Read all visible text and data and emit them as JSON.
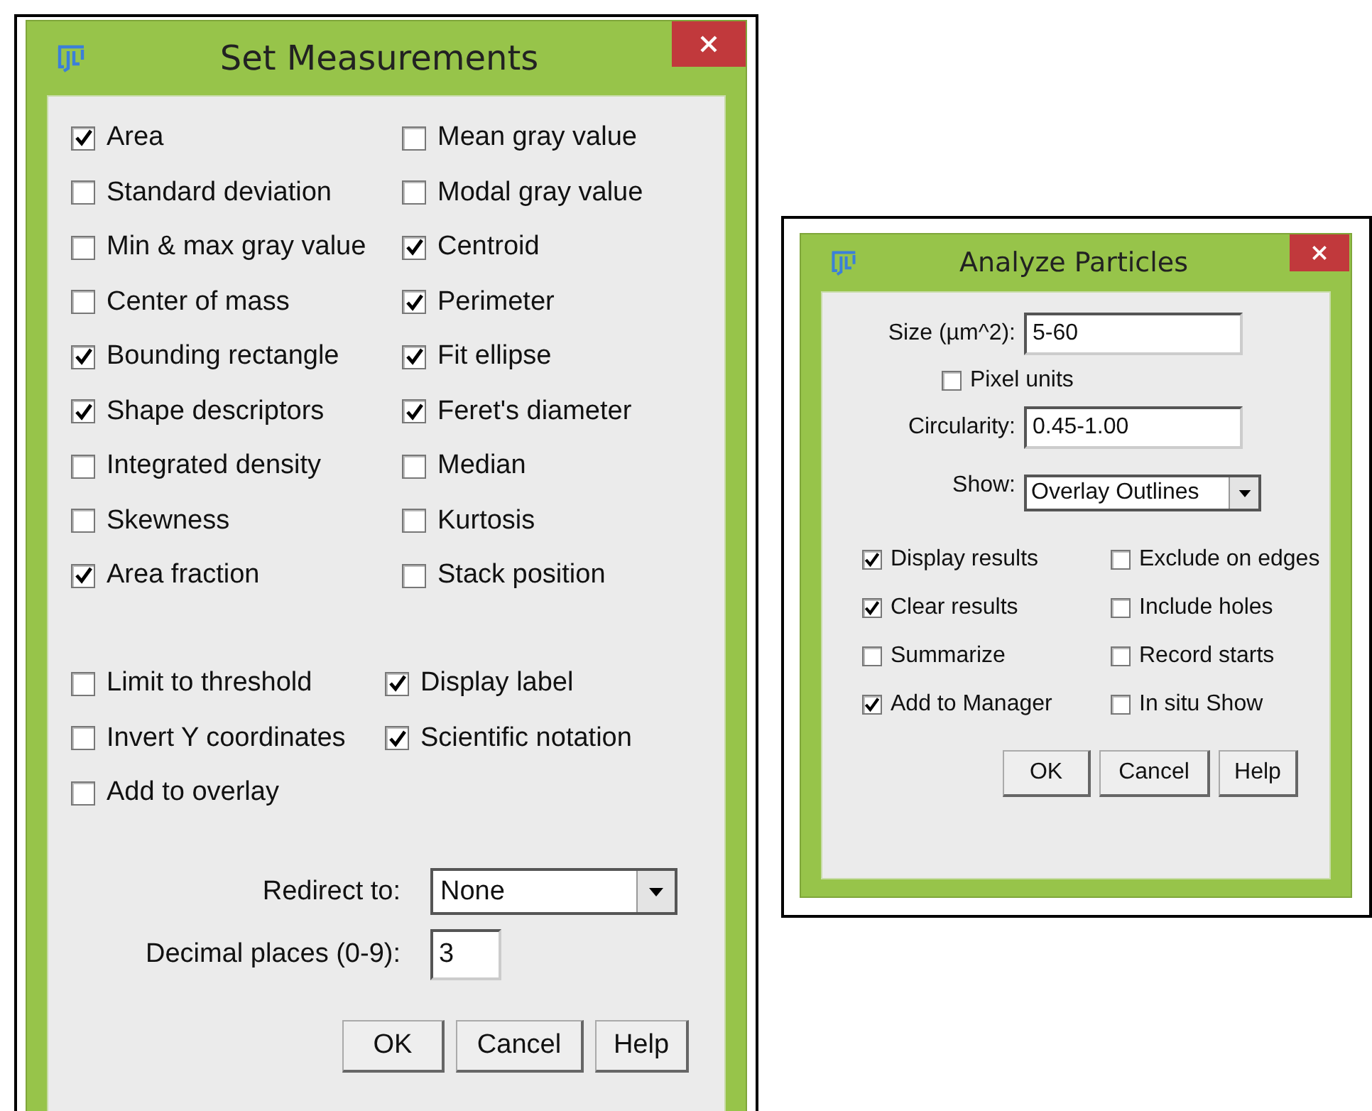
{
  "set_measurements": {
    "title": "Set Measurements",
    "measurements": [
      {
        "label": "Area",
        "checked": true
      },
      {
        "label": "Mean gray value",
        "checked": false
      },
      {
        "label": "Standard deviation",
        "checked": false
      },
      {
        "label": "Modal gray value",
        "checked": false
      },
      {
        "label": "Min & max gray value",
        "checked": false
      },
      {
        "label": "Centroid",
        "checked": true
      },
      {
        "label": "Center of mass",
        "checked": false
      },
      {
        "label": "Perimeter",
        "checked": true
      },
      {
        "label": "Bounding rectangle",
        "checked": true
      },
      {
        "label": "Fit ellipse",
        "checked": true
      },
      {
        "label": "Shape descriptors",
        "checked": true
      },
      {
        "label": "Feret's diameter",
        "checked": true
      },
      {
        "label": "Integrated density",
        "checked": false
      },
      {
        "label": "Median",
        "checked": false
      },
      {
        "label": "Skewness",
        "checked": false
      },
      {
        "label": "Kurtosis",
        "checked": false
      },
      {
        "label": "Area fraction",
        "checked": true
      },
      {
        "label": "Stack position",
        "checked": false
      }
    ],
    "options": [
      {
        "label": "Limit to threshold",
        "checked": false
      },
      {
        "label": "Display label",
        "checked": true
      },
      {
        "label": "Invert Y coordinates",
        "checked": false
      },
      {
        "label": "Scientific notation",
        "checked": true
      },
      {
        "label": "Add to overlay",
        "checked": false
      }
    ],
    "redirect": {
      "label": "Redirect to:",
      "value": "None"
    },
    "decimal_places": {
      "label": "Decimal places (0-9):",
      "value": "3"
    },
    "buttons": [
      "OK",
      "Cancel",
      "Help"
    ]
  },
  "analyze_particles": {
    "title": "Analyze Particles",
    "size": {
      "label": "Size (µm^2):",
      "value": "5-60"
    },
    "pixel_units": {
      "label": "Pixel units",
      "checked": false
    },
    "circularity": {
      "label": "Circularity:",
      "value": "0.45-1.00"
    },
    "show": {
      "label": "Show:",
      "value": "Overlay Outlines"
    },
    "options": [
      {
        "label": "Display results",
        "checked": true
      },
      {
        "label": "Exclude on edges",
        "checked": false
      },
      {
        "label": "Clear results",
        "checked": true
      },
      {
        "label": "Include holes",
        "checked": false
      },
      {
        "label": "Summarize",
        "checked": false
      },
      {
        "label": "Record starts",
        "checked": false
      },
      {
        "label": "Add to Manager",
        "checked": true
      },
      {
        "label": "In situ Show",
        "checked": false
      }
    ],
    "buttons": [
      "OK",
      "Cancel",
      "Help"
    ]
  }
}
